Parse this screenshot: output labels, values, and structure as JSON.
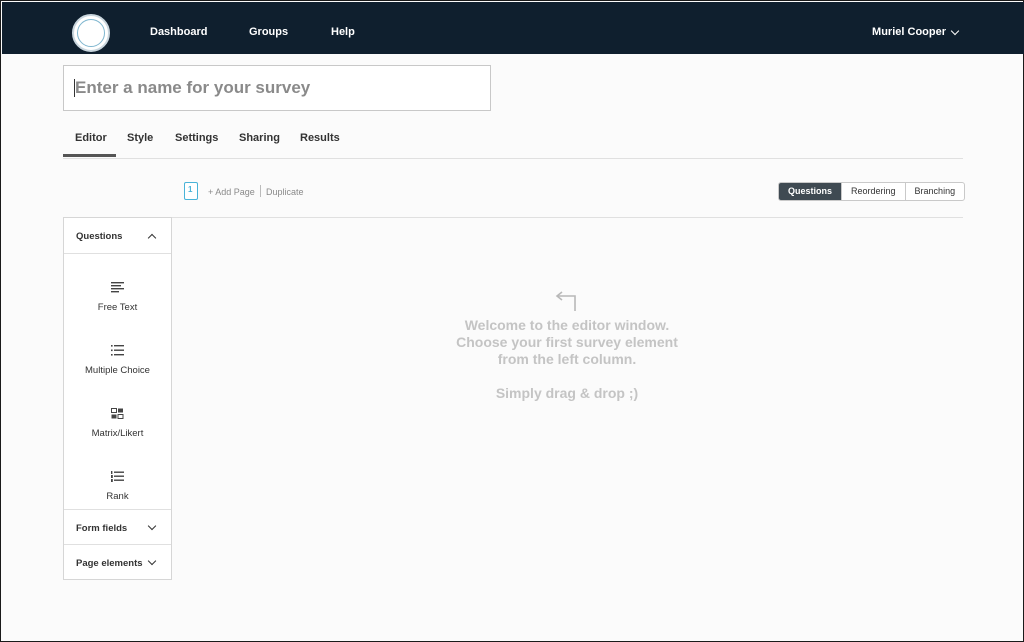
{
  "header": {
    "logo_icon": "survey-logo",
    "logo_text": "",
    "nav": [
      "Dashboard",
      "Groups",
      "Help"
    ],
    "user_name": "Muriel Cooper",
    "user_icon": "chevron-down-icon"
  },
  "survey": {
    "name_placeholder": "Enter a name for your survey",
    "name_value": ""
  },
  "tabs": [
    "Editor",
    "Style",
    "Settings",
    "Sharing",
    "Results"
  ],
  "active_tab": "Editor",
  "page_toolbar": {
    "page_icon": "page-icon",
    "page_number": "1",
    "add_page": "+ Add Page",
    "duplicate": "Duplicate"
  },
  "view_modes": {
    "options": [
      "Questions",
      "Reordering",
      "Branching"
    ],
    "selected": "Questions"
  },
  "palette": {
    "questions_header": "Questions",
    "items": [
      {
        "label": "Free Text",
        "icon": "free-text-icon"
      },
      {
        "label": "Multiple Choice",
        "icon": "list-icon"
      },
      {
        "label": "Matrix/Likert",
        "icon": "matrix-icon"
      },
      {
        "label": "Rank",
        "icon": "rank-list-icon"
      }
    ],
    "form_fields_header": "Form fields",
    "page_elements_header": "Page elements"
  },
  "editor": {
    "welcome_lines": [
      "Welcome to the editor window.",
      "Choose your first survey element",
      "from the left column."
    ],
    "hint": "Simply drag & drop ;)",
    "arrow_icon": "arrow-up-left-icon"
  },
  "colors": {
    "navbar": "#0f1f2e",
    "accent_blue": "#49b3d8",
    "active_segment": "#3f4a52",
    "welcome_text": "#c4c4c4"
  }
}
